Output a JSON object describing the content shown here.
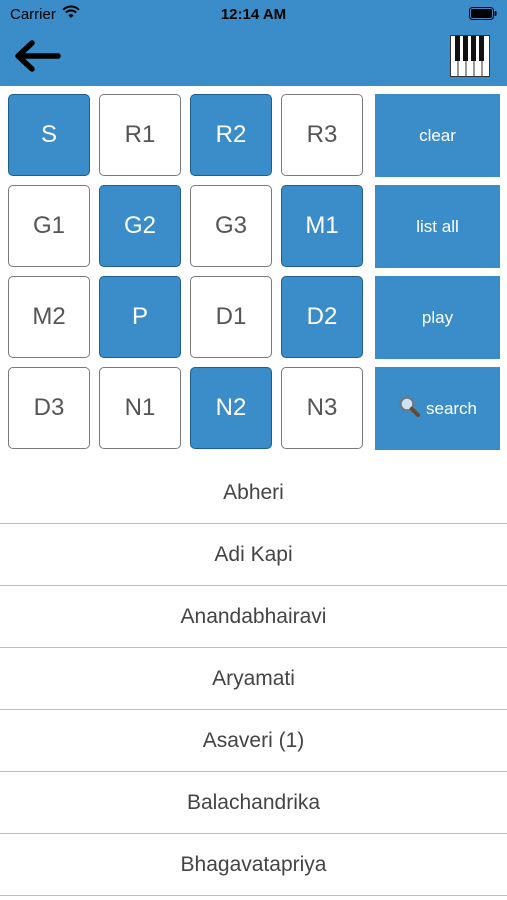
{
  "status_bar": {
    "carrier": "Carrier",
    "time": "12:14 AM"
  },
  "header": {
    "back_icon": "arrow-left-icon",
    "piano_icon": "piano-keyboard-icon",
    "accent": "#3a8dc8"
  },
  "notes": [
    {
      "label": "S",
      "selected": true
    },
    {
      "label": "R1",
      "selected": false
    },
    {
      "label": "R2",
      "selected": true
    },
    {
      "label": "R3",
      "selected": false
    },
    {
      "label": "G1",
      "selected": false
    },
    {
      "label": "G2",
      "selected": true
    },
    {
      "label": "G3",
      "selected": false
    },
    {
      "label": "M1",
      "selected": true
    },
    {
      "label": "M2",
      "selected": false
    },
    {
      "label": "P",
      "selected": true
    },
    {
      "label": "D1",
      "selected": false
    },
    {
      "label": "D2",
      "selected": true
    },
    {
      "label": "D3",
      "selected": false
    },
    {
      "label": "N1",
      "selected": false
    },
    {
      "label": "N2",
      "selected": true
    },
    {
      "label": "N3",
      "selected": false
    }
  ],
  "actions": {
    "clear": "clear",
    "list_all": "list all",
    "play": "play",
    "search": "search",
    "search_icon": "magnifier-icon"
  },
  "ragas": [
    "Abheri",
    "Adi Kapi",
    "Anandabhairavi",
    "Aryamati",
    "Asaveri (1)",
    "Balachandrika",
    "Bhagavatapriya"
  ]
}
